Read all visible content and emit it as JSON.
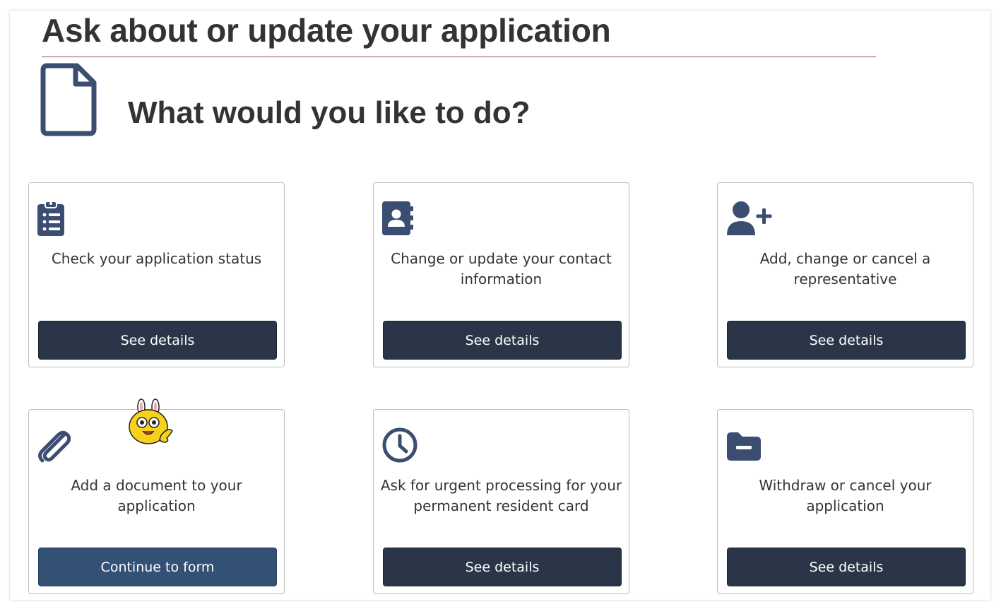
{
  "page": {
    "title": "Ask about or update your application",
    "subtitle": "What would you like to do?"
  },
  "colors": {
    "icon": "#3c4d72",
    "button_dark": "#2b3548",
    "button_primary": "#335075",
    "title_rule": "#9e4a4a"
  },
  "cards": [
    {
      "icon": "clipboard-list-icon",
      "text": "Check your application status",
      "button": "See details"
    },
    {
      "icon": "address-book-icon",
      "text": "Change or update your contact information",
      "button": "See details"
    },
    {
      "icon": "user-plus-icon",
      "text": "Add, change or cancel a representative",
      "button": "See details"
    },
    {
      "icon": "paperclip-icon",
      "text": "Add a document to your application",
      "button": "Continue to form"
    },
    {
      "icon": "clock-icon",
      "text": "Ask for urgent processing for your permanent resident card",
      "button": "See details"
    },
    {
      "icon": "folder-minus-icon",
      "text": "Withdraw or cancel your application",
      "button": "See details"
    }
  ]
}
